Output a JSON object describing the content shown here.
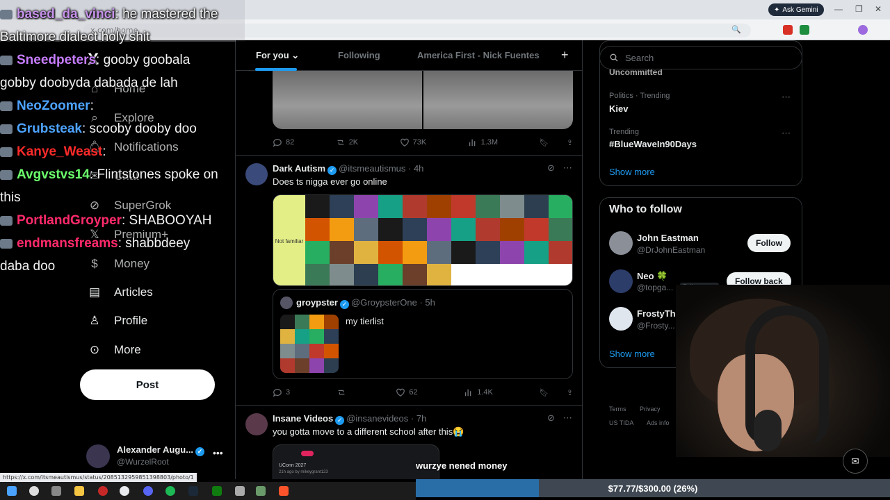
{
  "browser": {
    "url": "x.com/home",
    "gemini_label": "Ask Gemini",
    "status_url": "https://x.com/itsmeautismus/status/2085132959851398803/photo/1"
  },
  "chat": {
    "lines": [
      {
        "name": "based_da_vinci",
        "color": "#c792ea",
        "text": ": he mastered the"
      },
      {
        "name": "",
        "color": "#ffffff",
        "text": "Baltimore dialect holy shit"
      },
      {
        "name": "Sneedpeters",
        "color": "#c77dff",
        "text": ": gooby goobala"
      },
      {
        "name": "",
        "color": "#ffffff",
        "text": "gobby doobyda dabada de lah"
      },
      {
        "name": "NeoZoomer",
        "color": "#4da3ff",
        "text": ":"
      },
      {
        "name": "Grubsteak",
        "color": "#4da3ff",
        "text": ": scooby dooby doo"
      },
      {
        "name": "Kanye_Weast",
        "color": "#ff2a2a",
        "text": ":"
      },
      {
        "name": "Avgvstvs14",
        "color": "#6cff6c",
        "text": ": Flintstones spoke on"
      },
      {
        "name": "",
        "color": "#ffffff",
        "text": "this"
      },
      {
        "name": "PortlandGroyper",
        "color": "#ff2a6b",
        "text": ": SHABOOYAH"
      },
      {
        "name": "endmansfreams",
        "color": "#ff2a6b",
        "text": ": shabbdeey"
      },
      {
        "name": "",
        "color": "#ffffff",
        "text": "daba doo"
      }
    ]
  },
  "nav": {
    "logo": "X",
    "home": "Home",
    "explore": "Explore",
    "notifications": "Notifications",
    "chat": "Chat",
    "supergrok": "SuperGrok",
    "premium": "Premium+",
    "money": "Money",
    "articles": "Articles",
    "profile": "Profile",
    "more": "More",
    "post": "Post"
  },
  "account": {
    "name": "Alexander Augu...",
    "handle": "@WurzelRoot"
  },
  "tabs": {
    "for_you": "For you",
    "following": "Following",
    "list": "America First - Nick Fuentes"
  },
  "post1": {
    "replies": "82",
    "reposts": "2K",
    "likes": "73K",
    "views": "1.3M"
  },
  "post2": {
    "name": "Dark Autism",
    "handle": "@itsmeautismus",
    "time": "· 4h",
    "text": "Does ts nigga ever go online",
    "tier_label": "Not familiar",
    "quote": {
      "name": "groypster",
      "handle": "@GroypsterOne",
      "time": "· 5h",
      "text": "my tierlist"
    },
    "replies": "3",
    "reposts": "",
    "likes": "62",
    "views": "1.4K"
  },
  "post3": {
    "name": "Insane Videos",
    "handle": "@insanevideos",
    "time": "· 7h",
    "text": "you gotta move to a different school after this😭",
    "media_line1": "UConn 2027",
    "media_line2": "21h ago by mikeygrant123"
  },
  "sidebar": {
    "search_placeholder": "Search",
    "uncommitted": "Uncommitted",
    "trends": [
      {
        "category": "Politics · Trending",
        "name": "Kiev"
      },
      {
        "category": "Trending",
        "name": "#BlueWaveIn90Days"
      }
    ],
    "show_more": "Show more",
    "who_to_follow": "Who to follow",
    "follow": [
      {
        "name": "John Eastman",
        "handle": "@DrJohnEastman",
        "button": "Follow"
      },
      {
        "name": "Neo 🍀",
        "handle": "@topga...",
        "button": "Follow back",
        "badge": "Follows you"
      },
      {
        "name": "FrostyTheGroy",
        "handle": "@Frosty...",
        "button": ""
      }
    ],
    "show_more2": "Show more",
    "footer": [
      "Terms",
      "Privacy",
      "US TIDA",
      "Ads info"
    ]
  },
  "overlay": {
    "caption": "wurzye nened money",
    "donation": "$77.77/$300.00 (26%)",
    "donation_progress": 0.26
  },
  "colors": {
    "accent": "#1d9bf0",
    "background": "#000000",
    "border": "#2f3336",
    "muted": "#71767b"
  }
}
